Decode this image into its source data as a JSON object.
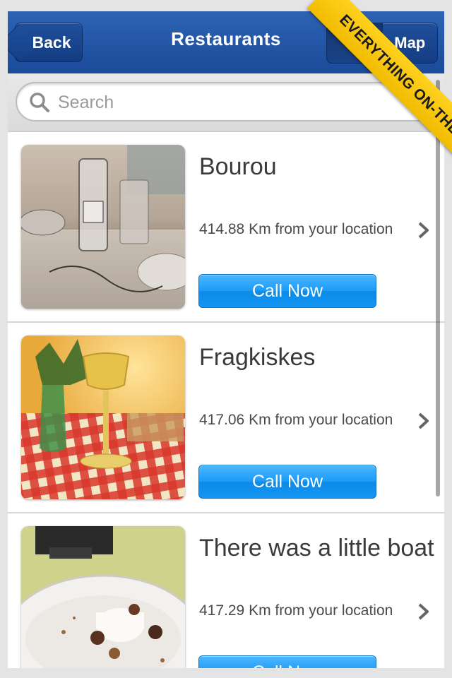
{
  "navbar": {
    "back_label": "Back",
    "title": "Restaurants",
    "segments": [
      "",
      "Map"
    ]
  },
  "search": {
    "placeholder": "Search"
  },
  "ribbon": {
    "text": "EVERYTHING ON-THE-GO"
  },
  "restaurants": [
    {
      "name": "Bourou",
      "distance": "414.88 Km from your location",
      "call_label": "Call Now"
    },
    {
      "name": "Fragkiskes",
      "distance": "417.06 Km from your location",
      "call_label": "Call Now"
    },
    {
      "name": "There was a little boat",
      "distance": "417.29 Km from your location",
      "call_label": "Call Now"
    }
  ],
  "colors": {
    "navbar": "#1f52a3",
    "call_button": "#1a9af7",
    "ribbon": "#f5c400"
  }
}
